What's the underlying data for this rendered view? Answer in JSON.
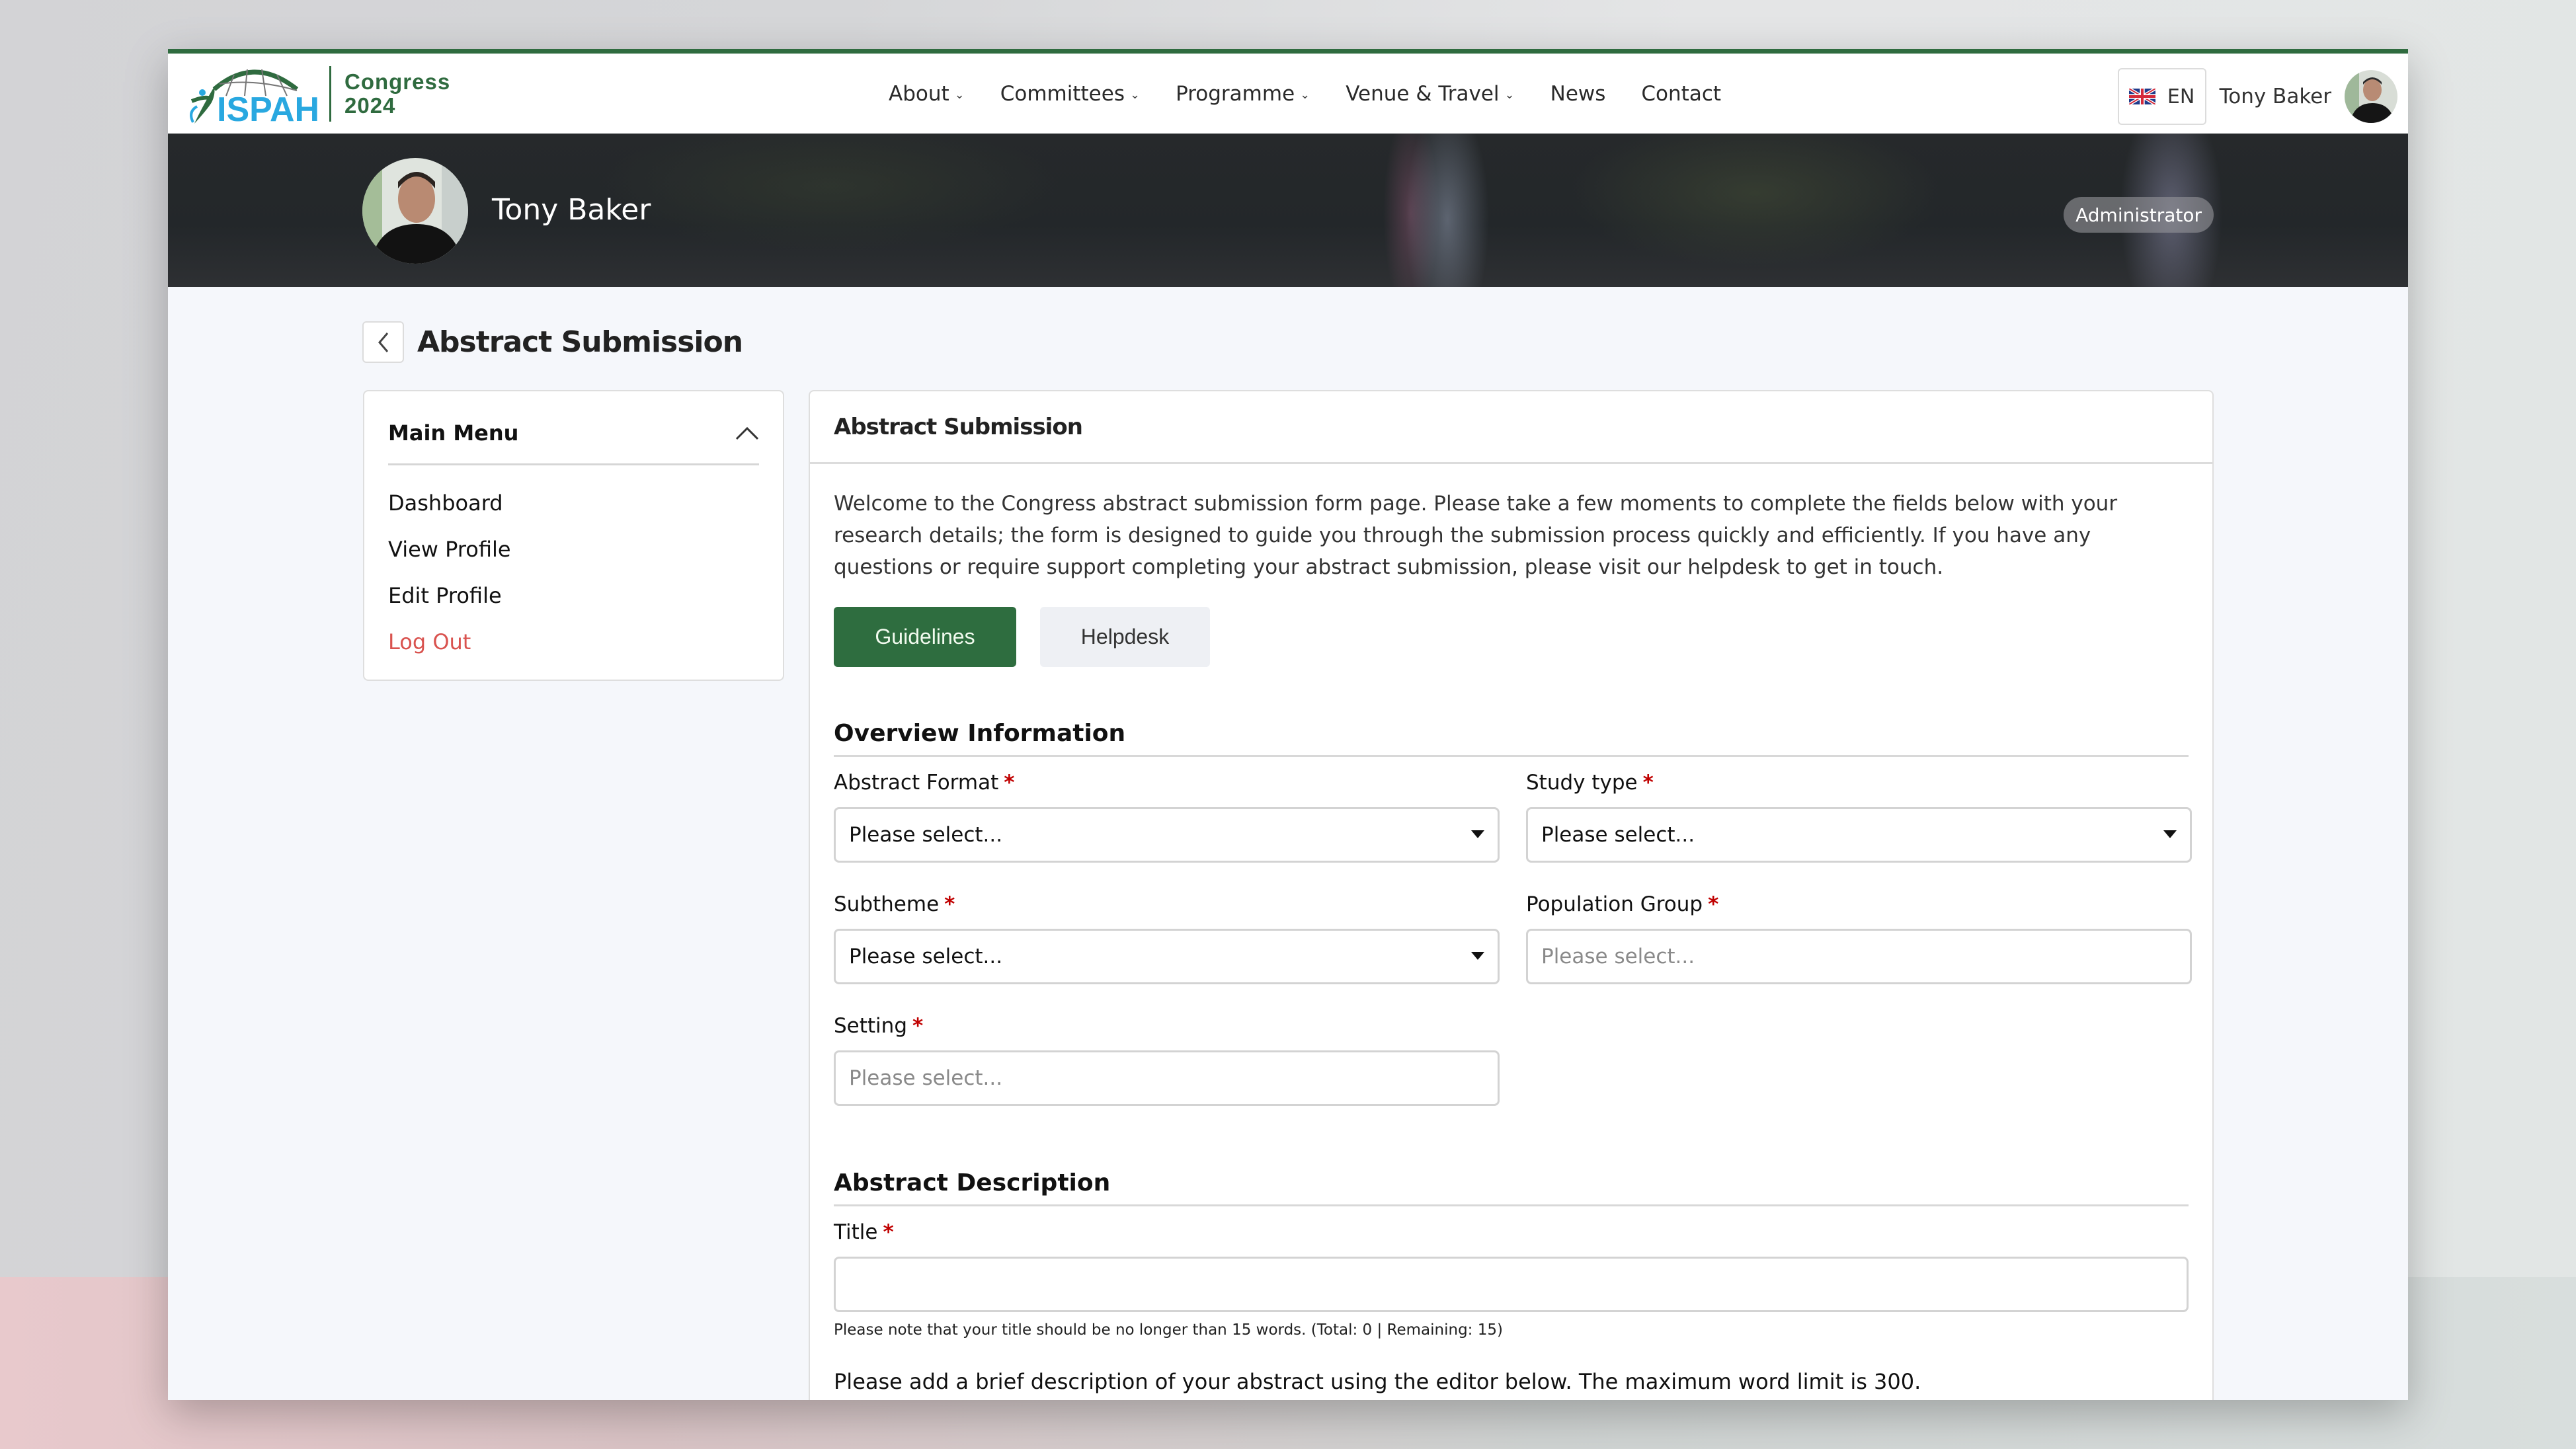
{
  "brand": {
    "logo_text": "ISPAH",
    "congress_line1": "Congress",
    "congress_line2": "2024",
    "accent_green": "#2f6b3f",
    "logo_blue": "#29a8e0"
  },
  "nav": {
    "links": [
      {
        "label": "About",
        "has_dropdown": true
      },
      {
        "label": "Committees",
        "has_dropdown": true
      },
      {
        "label": "Programme",
        "has_dropdown": true
      },
      {
        "label": "Venue & Travel",
        "has_dropdown": true
      },
      {
        "label": "News",
        "has_dropdown": false
      },
      {
        "label": "Contact",
        "has_dropdown": false
      }
    ],
    "caret_glyph": "⌄",
    "language": "EN",
    "language_flag": "uk-flag-icon",
    "user_name": "Tony Baker"
  },
  "banner": {
    "user_name": "Tony Baker",
    "role_badge": "Administrator"
  },
  "page": {
    "title": "Abstract Submission",
    "back_icon": "chevron-left-icon"
  },
  "sidebar": {
    "title": "Main Menu",
    "collapse_icon": "chevron-up-icon",
    "items": [
      {
        "label": "Dashboard"
      },
      {
        "label": "View Profile"
      },
      {
        "label": "Edit Profile"
      },
      {
        "label": "Log Out",
        "color": "#d9534f"
      }
    ]
  },
  "main": {
    "card_title": "Abstract Submission",
    "intro": "Welcome to the Congress abstract submission form page. Please take a few moments to complete the fields below with your research details; the form is designed to guide you through the submission process quickly and efficiently. If you have any questions or require support completing your abstract submission, please visit our helpdesk to get in touch.",
    "buttons": {
      "guidelines": "Guidelines",
      "helpdesk": "Helpdesk",
      "primary_color": "#2e6d3f"
    },
    "overview": {
      "title": "Overview Information",
      "required_marker": "*",
      "fields": {
        "abstract_format": {
          "label": "Abstract Format",
          "value": "Please select..."
        },
        "study_type": {
          "label": "Study type",
          "value": "Please select..."
        },
        "subtheme": {
          "label": "Subtheme",
          "value": "Please select..."
        },
        "population_group": {
          "label": "Population Group",
          "placeholder": "Please select..."
        },
        "setting": {
          "label": "Setting",
          "placeholder": "Please select..."
        }
      }
    },
    "description": {
      "title": "Abstract Description",
      "title_field_label": "Title",
      "title_value": "",
      "title_help": "Please note that your title should be no longer than 15 words. (Total: 0 | Remaining: 15)",
      "editor_instructions": "Please add a brief description of your abstract using the editor below. The maximum word limit is 300."
    }
  }
}
